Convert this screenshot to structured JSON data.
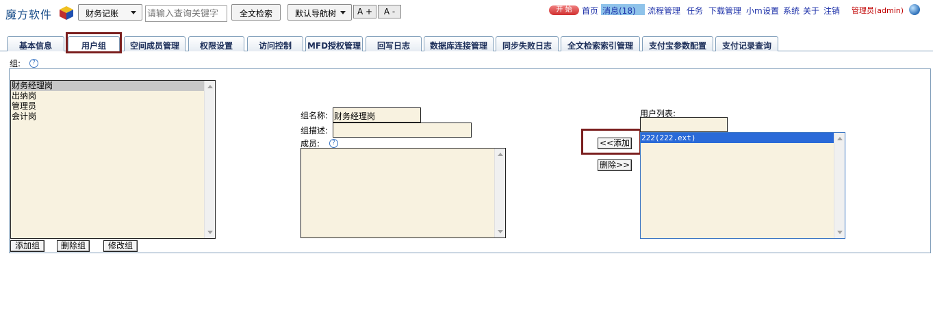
{
  "header": {
    "logo_text": "魔方软件",
    "module_select": "财务记账",
    "search_placeholder": "请输入查询关键字",
    "search_button": "全文检索",
    "navtree_button": "默认导航树",
    "font_increase": "A +",
    "font_decrease": "A -",
    "start_badge": "开 始",
    "links": {
      "home": "首页",
      "messages": "消息(18)",
      "workflow": "流程管理",
      "tasks": "任务",
      "downloads": "下载管理",
      "xiaom": "小m",
      "settings": "设置",
      "system": "系统",
      "about": "关于",
      "logout": "注销"
    },
    "admin_label": "管理员(admin)"
  },
  "tabs": [
    {
      "label": "基本信息"
    },
    {
      "label": "用户组"
    },
    {
      "label": "空间成员管理"
    },
    {
      "label": "权限设置"
    },
    {
      "label": "访问控制"
    },
    {
      "label": "MFD授权管理"
    },
    {
      "label": "回写日志"
    },
    {
      "label": "数据库连接管理"
    },
    {
      "label": "同步失败日志"
    },
    {
      "label": "全文检索索引管理"
    },
    {
      "label": "支付宝参数配置"
    },
    {
      "label": "支付记录查询"
    }
  ],
  "group_section": {
    "label": "组:",
    "groups": [
      "财务经理岗",
      "出纳岗",
      "管理员",
      "会计岗"
    ],
    "selected_group": "财务经理岗",
    "buttons": {
      "add": "添加组",
      "delete": "删除组",
      "edit": "修改组"
    }
  },
  "form": {
    "name_label": "组名称:",
    "name_value": "财务经理岗",
    "desc_label": "组描述:",
    "desc_value": "",
    "members_label": "成员:"
  },
  "actions": {
    "add": "<<添加",
    "remove": "删除>>"
  },
  "user_list": {
    "label": "用户列表:",
    "filter_value": "",
    "users": [
      "222(222.ext)"
    ]
  },
  "colors": {
    "highlight": "#7a1e1e",
    "field_bg": "#f8f2e0",
    "tab_border": "#7f9db9"
  }
}
